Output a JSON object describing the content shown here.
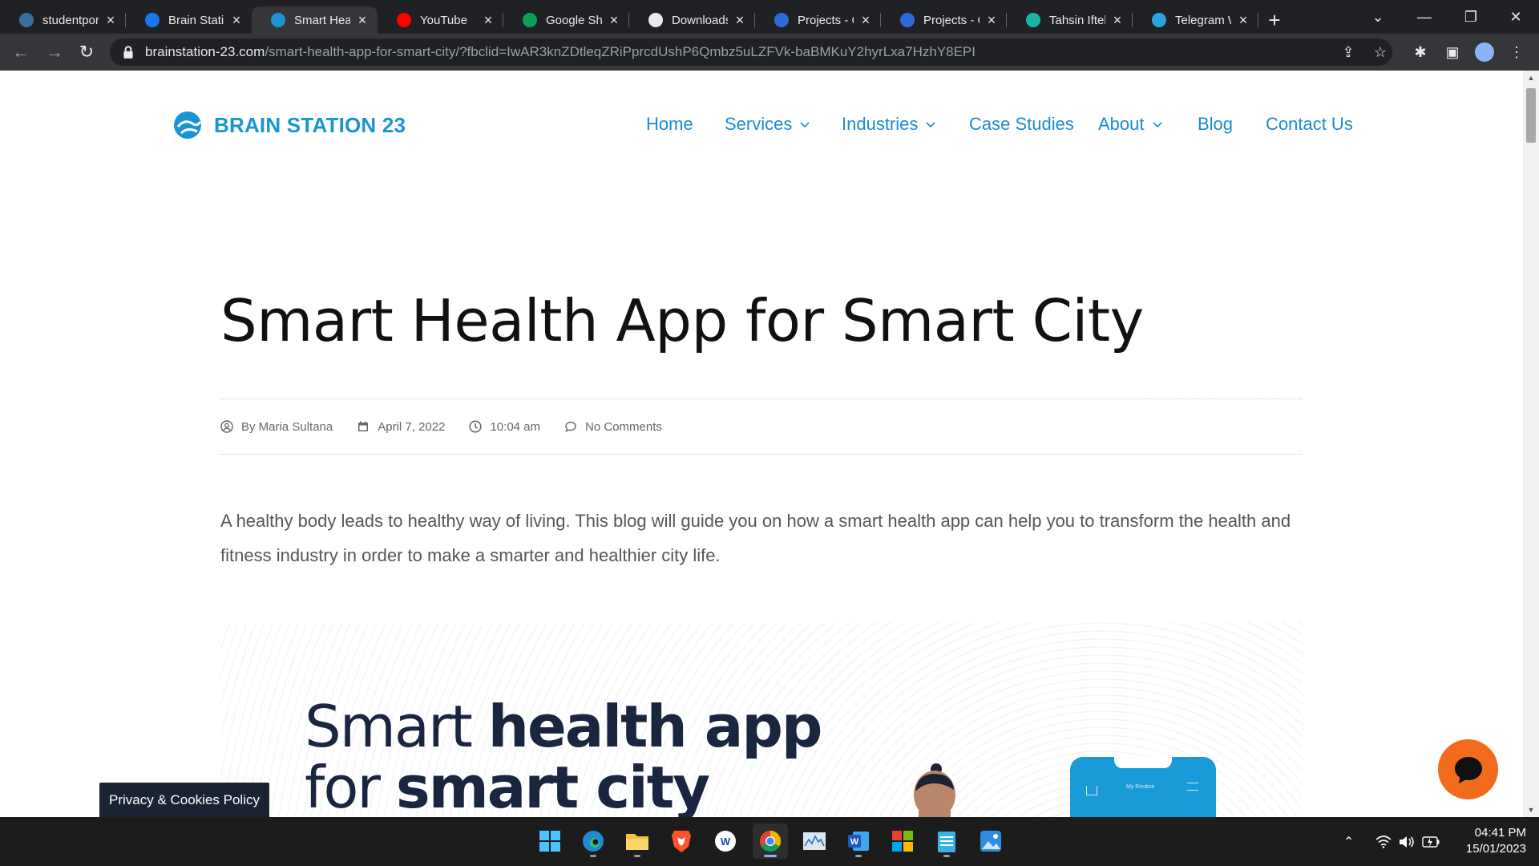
{
  "browser": {
    "tabs": [
      {
        "title": "studentport",
        "favicon": "studentportal-icon",
        "color": "#3c6e9b"
      },
      {
        "title": "Brain Statio",
        "favicon": "facebook-icon",
        "color": "#1877f2"
      },
      {
        "title": "Smart Healt",
        "favicon": "brainstation-icon",
        "color": "#1a95d2"
      },
      {
        "title": "YouTube",
        "favicon": "youtube-icon",
        "color": "#ff0000"
      },
      {
        "title": "Google She",
        "favicon": "google-sheets-icon",
        "color": "#0f9d58"
      },
      {
        "title": "Downloads",
        "favicon": "download-icon",
        "color": "#e8eaed"
      },
      {
        "title": "Projects - C",
        "favicon": "canva-icon",
        "color": "#2f6bd8"
      },
      {
        "title": "Projects - C",
        "favicon": "canva-icon",
        "color": "#2f6bd8"
      },
      {
        "title": "Tahsin Iftek",
        "favicon": "shield-icon",
        "color": "#1ab4a5"
      },
      {
        "title": "Telegram W",
        "favicon": "telegram-icon",
        "color": "#2aa3de"
      }
    ],
    "active_tab": 2,
    "url_host": "brainstation-23.com",
    "url_path": "/smart-health-app-for-smart-city/?fbclid=IwAR3knZDtleqZRiPprcdUshP6Qmbz5uLZFVk-baBMKuY2hyrLxa7HzhY8EPI"
  },
  "site": {
    "logo_text": "BRAIN STATION 23",
    "brand_color": "#1a95d2",
    "nav": [
      {
        "label": "Home",
        "dropdown": false
      },
      {
        "label": "Services",
        "dropdown": true
      },
      {
        "label": "Industries",
        "dropdown": true
      },
      {
        "label": "Case Studies",
        "dropdown": false
      },
      {
        "label": "About",
        "dropdown": true
      },
      {
        "label": "Blog",
        "dropdown": false
      },
      {
        "label": "Contact Us",
        "dropdown": false
      }
    ]
  },
  "post": {
    "title": "Smart Health App for Smart City",
    "meta": {
      "author": "By Maria Sultana",
      "date": "April 7, 2022",
      "time": "10:04 am",
      "comments": "No Comments"
    },
    "intro": "A healthy body leads to healthy way of living. This blog will guide you on how a smart health app can help you to transform the health and fitness industry in order to make a smarter and healthier city life.",
    "hero": {
      "line1_light": "Smart ",
      "line1_bold": "health app",
      "line2_light": "for ",
      "line2_bold": "smart city",
      "phone_label": "My Routine"
    }
  },
  "overlays": {
    "privacy_label": "Privacy & Cookies Policy",
    "chat_color": "#f26b1d"
  },
  "taskbar": {
    "apps": [
      "windows-start-icon",
      "edge-icon",
      "file-explorer-icon",
      "brave-icon",
      "app-w-icon",
      "chrome-icon",
      "monitor-icon",
      "word-icon",
      "office-icon",
      "notepad-icon",
      "photos-icon"
    ],
    "time": "04:41 PM",
    "date": "15/01/2023"
  }
}
